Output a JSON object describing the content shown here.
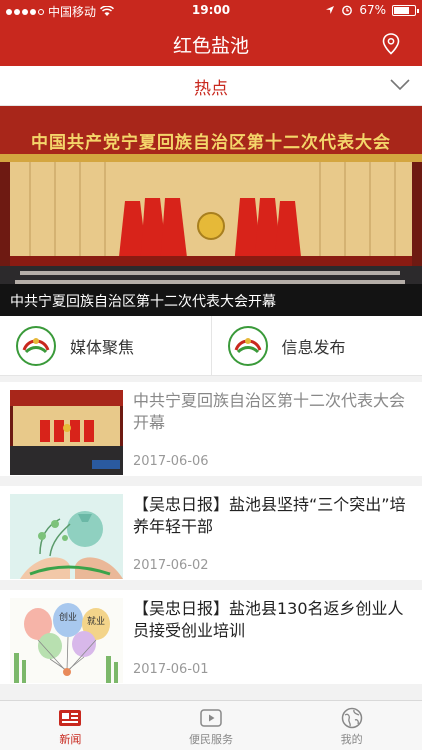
{
  "status_bar": {
    "carrier": "中国移动",
    "time": "19:00",
    "battery": "67%"
  },
  "header": {
    "title": "红色盐池"
  },
  "channel": {
    "label": "热点"
  },
  "banner": {
    "headline_on_image": "中国共产党宁夏回族自治区第十二次代表大会",
    "caption": "中共宁夏回族自治区第十二次代表大会开幕"
  },
  "quick_entries": [
    {
      "label": "媒体聚焦"
    },
    {
      "label": "信息发布"
    }
  ],
  "news": [
    {
      "title": "中共宁夏回族自治区第十二次代表大会开幕",
      "date": "2017-06-06"
    },
    {
      "title": "【吴忠日报】盐池县坚持“三个突出”培养年轻干部",
      "date": "2017-06-02"
    },
    {
      "title": "【吴忠日报】盐池县130名返乡创业人员接受创业培训",
      "date": "2017-06-01",
      "balloon_labels": [
        "创业",
        "就业"
      ]
    }
  ],
  "tabs": [
    {
      "label": "新闻",
      "icon": "news-icon",
      "active": true
    },
    {
      "label": "便民服务",
      "icon": "play-icon",
      "active": false
    },
    {
      "label": "我的",
      "icon": "globe-icon",
      "active": false
    }
  ],
  "colors": {
    "brand_red": "#c8281e",
    "read_title_gray": "#888888"
  }
}
